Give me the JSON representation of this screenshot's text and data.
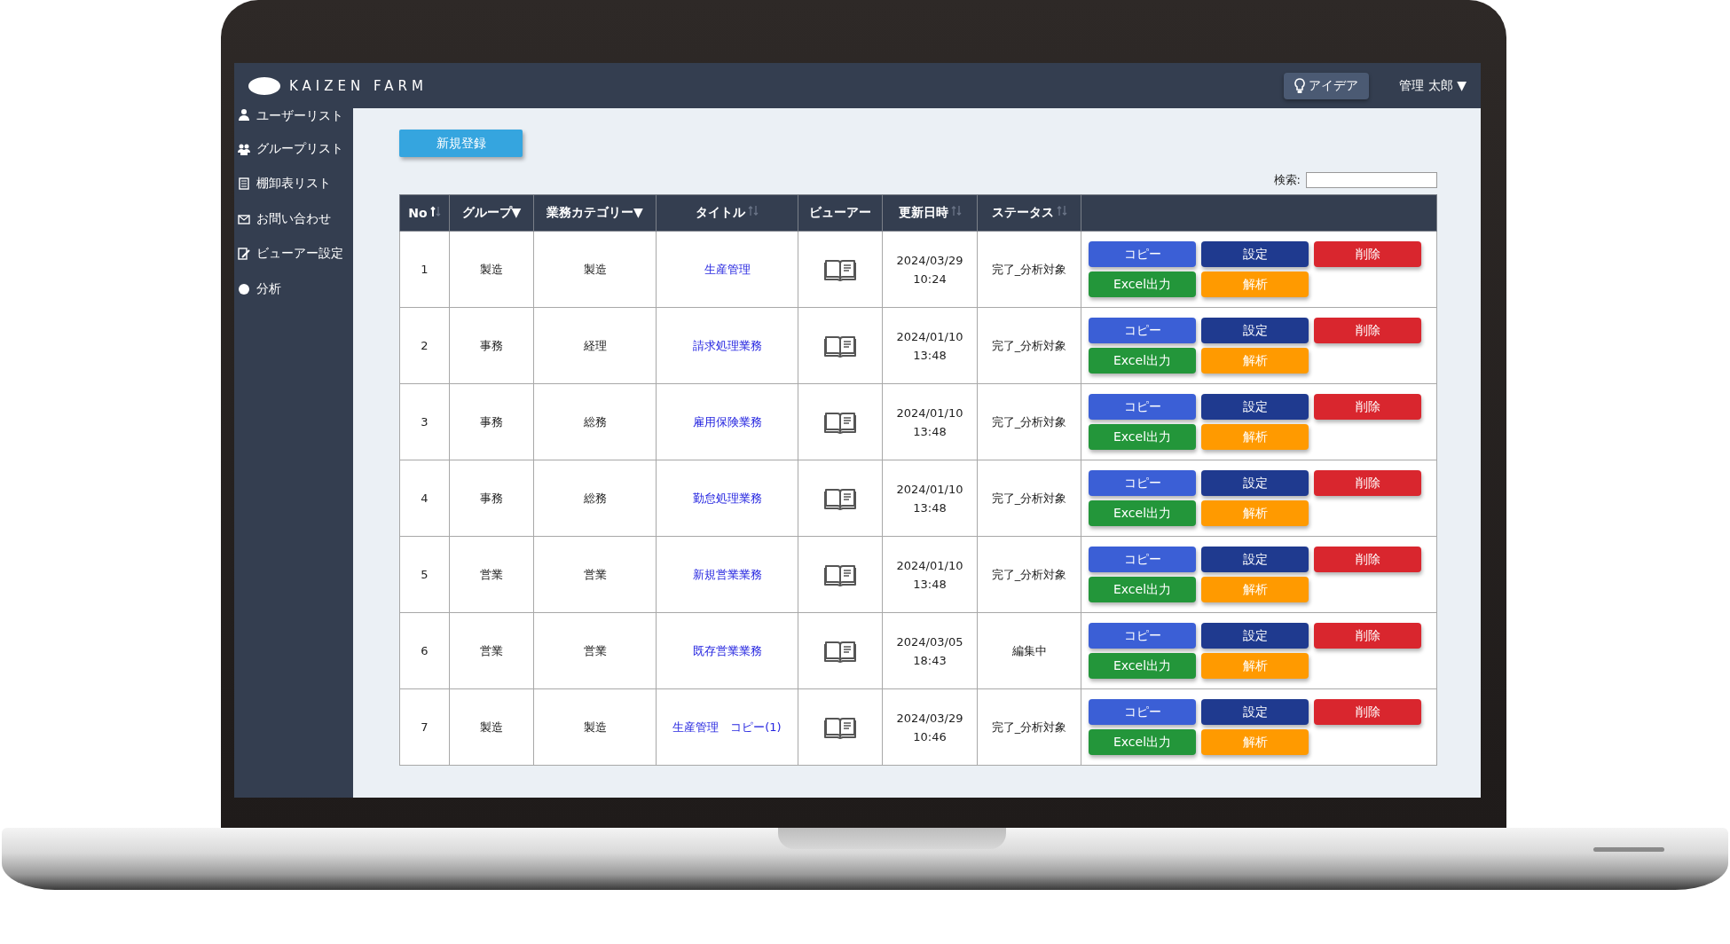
{
  "header": {
    "logo": "KAIZEN FARM",
    "idea_button": "アイデア",
    "user_menu": "管理 太郎 ▼"
  },
  "sidebar": {
    "items": [
      {
        "label": "ユーザーリスト"
      },
      {
        "label": "グループリスト"
      },
      {
        "label": "棚卸表リスト"
      },
      {
        "label": "お問い合わせ"
      },
      {
        "label": "ビューアー設定"
      },
      {
        "label": "分析"
      }
    ]
  },
  "new_button": "新規登録",
  "search": {
    "label": "検索:"
  },
  "table": {
    "columns": [
      {
        "label": "No",
        "sortable": true,
        "sorted": true
      },
      {
        "label": "グループ▼",
        "sortable": false
      },
      {
        "label": "業務カテゴリー▼",
        "sortable": false
      },
      {
        "label": "タイトル",
        "sortable": true,
        "sorted": false
      },
      {
        "label": "ビューアー",
        "sortable": false
      },
      {
        "label": "更新日時",
        "sortable": true,
        "sorted": false
      },
      {
        "label": "ステータス",
        "sortable": true,
        "sorted": false
      }
    ],
    "rows": [
      {
        "no": "1",
        "group": "製造",
        "category": "製造",
        "title": "生産管理",
        "date": "2024/03/29",
        "time": "10:24",
        "status": "完了_分析対象",
        "actions": [
          {
            "label": "コピー",
            "color": "#3b5fd6"
          },
          {
            "label": "設定",
            "color": "#1f3a8f"
          },
          {
            "label": "削除",
            "color": "#d9262e"
          },
          {
            "label": "Excel出力",
            "color": "#23963a"
          },
          {
            "label": "解析",
            "color": "#ff9a00"
          }
        ]
      },
      {
        "no": "2",
        "group": "事務",
        "category": "経理",
        "title": "請求処理業務",
        "date": "2024/01/10",
        "time": "13:48",
        "status": "完了_分析対象",
        "actions": [
          {
            "label": "コピー",
            "color": "#3b5fd6"
          },
          {
            "label": "設定",
            "color": "#1f3a8f"
          },
          {
            "label": "削除",
            "color": "#d9262e"
          },
          {
            "label": "Excel出力",
            "color": "#23963a"
          },
          {
            "label": "解析",
            "color": "#ff9a00"
          }
        ]
      },
      {
        "no": "3",
        "group": "事務",
        "category": "総務",
        "title": "雇用保険業務",
        "date": "2024/01/10",
        "time": "13:48",
        "status": "完了_分析対象",
        "actions": [
          {
            "label": "コピー",
            "color": "#3b5fd6"
          },
          {
            "label": "設定",
            "color": "#1f3a8f"
          },
          {
            "label": "削除",
            "color": "#d9262e"
          },
          {
            "label": "Excel出力",
            "color": "#23963a"
          },
          {
            "label": "解析",
            "color": "#ff9a00"
          }
        ]
      },
      {
        "no": "4",
        "group": "事務",
        "category": "総務",
        "title": "勤怠処理業務",
        "date": "2024/01/10",
        "time": "13:48",
        "status": "完了_分析対象",
        "actions": [
          {
            "label": "コピー",
            "color": "#3b5fd6"
          },
          {
            "label": "設定",
            "color": "#1f3a8f"
          },
          {
            "label": "削除",
            "color": "#d9262e"
          },
          {
            "label": "Excel出力",
            "color": "#23963a"
          },
          {
            "label": "解析",
            "color": "#ff9a00"
          }
        ]
      },
      {
        "no": "5",
        "group": "営業",
        "category": "営業",
        "title": "新規営業業務",
        "date": "2024/01/10",
        "time": "13:48",
        "status": "完了_分析対象",
        "actions": [
          {
            "label": "コピー",
            "color": "#3b5fd6"
          },
          {
            "label": "設定",
            "color": "#1f3a8f"
          },
          {
            "label": "削除",
            "color": "#d9262e"
          },
          {
            "label": "Excel出力",
            "color": "#23963a"
          },
          {
            "label": "解析",
            "color": "#ff9a00"
          }
        ]
      },
      {
        "no": "6",
        "group": "営業",
        "category": "営業",
        "title": "既存営業業務",
        "date": "2024/03/05",
        "time": "18:43",
        "status": "編集中",
        "actions": [
          {
            "label": "コピー",
            "color": "#3b5fd6"
          },
          {
            "label": "設定",
            "color": "#1f3a8f"
          },
          {
            "label": "削除",
            "color": "#d9262e"
          },
          {
            "label": "Excel出力",
            "color": "#23963a"
          },
          {
            "label": "解析",
            "color": "#ff9a00"
          }
        ]
      },
      {
        "no": "7",
        "group": "製造",
        "category": "製造",
        "title": "生産管理　コピー(1)",
        "date": "2024/03/29",
        "time": "10:46",
        "status": "完了_分析対象",
        "actions": [
          {
            "label": "コピー",
            "color": "#3b5fd6"
          },
          {
            "label": "設定",
            "color": "#1f3a8f"
          },
          {
            "label": "削除",
            "color": "#d9262e"
          },
          {
            "label": "Excel出力",
            "color": "#23963a"
          },
          {
            "label": "解析",
            "color": "#ff9a00"
          }
        ]
      }
    ]
  }
}
